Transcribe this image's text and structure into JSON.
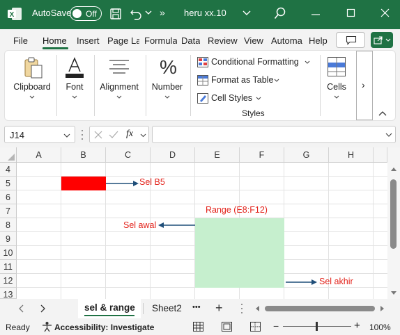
{
  "titlebar": {
    "autosave_label": "AutoSave",
    "toggle_state": "Off",
    "more": "»",
    "filename": "heru xx.10"
  },
  "tabs": [
    "File",
    "Home",
    "Insert",
    "Page La",
    "Formula",
    "Data",
    "Review",
    "View",
    "Automa",
    "Help"
  ],
  "ribbon": {
    "clipboard": "Clipboard",
    "font": "Font",
    "alignment": "Alignment",
    "number": "Number",
    "conditional_formatting": "Conditional Formatting",
    "format_as_table": "Format as Table",
    "cell_styles": "Cell Styles",
    "styles_group": "Styles",
    "cells": "Cells",
    "more": "›"
  },
  "formula_bar": {
    "name_box": "J14",
    "fx": "fx",
    "formula_value": ""
  },
  "grid": {
    "columns": [
      "A",
      "B",
      "C",
      "D",
      "E",
      "F",
      "G",
      "H"
    ],
    "rows": [
      "4",
      "5",
      "6",
      "7",
      "8",
      "9",
      "10",
      "11",
      "12",
      "13"
    ],
    "annotations": {
      "sel_b5": "Sel B5",
      "range_title": "Range (E8:F12)",
      "sel_awal": "Sel awal",
      "sel_akhir": "Sel akhir"
    },
    "colors": {
      "b5_fill": "#ff0000",
      "range_fill": "#c6efce",
      "arrow": "#1f4e79",
      "annotation_text": "#e3241c"
    }
  },
  "sheets": {
    "active": "sel & range",
    "other": "Sheet2",
    "more": "•••",
    "add": "+"
  },
  "status": {
    "ready": "Ready",
    "accessibility": "Accessibility: Investigate",
    "zoom": "100%",
    "minus": "−",
    "plus": "+"
  }
}
